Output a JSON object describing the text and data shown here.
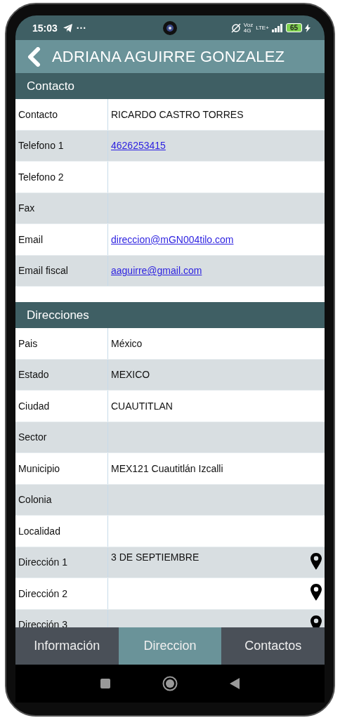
{
  "status_bar": {
    "time": "15:03",
    "more": "···",
    "network_voice": "Voz",
    "network_gen": "4G",
    "network_lte": "LTE+",
    "battery": "65"
  },
  "header": {
    "title": "ADRIANA AGUIRRE GONZALEZ"
  },
  "sections": [
    {
      "title": "Contacto",
      "rows": [
        {
          "label": "Contacto",
          "value": "RICARDO CASTRO TORRES",
          "kind": "text",
          "pin": false
        },
        {
          "label": "Telefono 1",
          "value": "4626253415",
          "kind": "link",
          "pin": false
        },
        {
          "label": "Telefono 2",
          "pin": false
        },
        {
          "label": "Fax",
          "pin": false
        },
        {
          "label": "Email",
          "value": "direccion@mGN004tilo.com",
          "kind": "link",
          "pin": false
        },
        {
          "label": "Email fiscal",
          "value": "aaguirre@gmail.com",
          "kind": "link",
          "pin": false
        }
      ]
    },
    {
      "title": "Direcciones",
      "rows": [
        {
          "label": "Pais",
          "value": "México",
          "kind": "text",
          "pin": false
        },
        {
          "label": "Estado",
          "value": "MEXICO",
          "kind": "text",
          "pin": false
        },
        {
          "label": "Ciudad",
          "value": "CUAUTITLAN",
          "kind": "text",
          "pin": false
        },
        {
          "label": "Sector",
          "pin": false
        },
        {
          "label": "Municipio",
          "value": "MEX121 Cuautitlán Izcalli",
          "kind": "text",
          "pin": false
        },
        {
          "label": "Colonia",
          "pin": false
        },
        {
          "label": "Localidad",
          "pin": false
        },
        {
          "label": "Dirección 1",
          "value": "3 DE SEPTIEMBRE",
          "kind": "text",
          "pin": true
        },
        {
          "label": "Dirección 2",
          "pin": true
        },
        {
          "label": "Dirección 3",
          "pin": true
        }
      ]
    }
  ],
  "tabs": [
    {
      "label": "Información",
      "selected": false
    },
    {
      "label": "Direccion",
      "selected": true
    },
    {
      "label": "Contactos",
      "selected": false
    }
  ]
}
